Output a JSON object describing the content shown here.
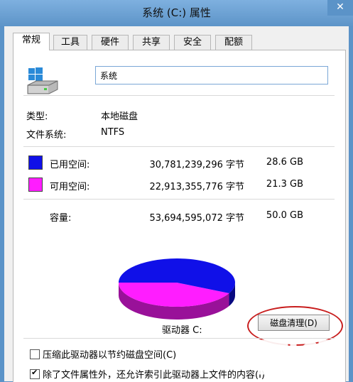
{
  "window": {
    "title": "系统 (C:) 属性",
    "close_glyph": "✕"
  },
  "tabs": [
    {
      "label": "常规",
      "active": true
    },
    {
      "label": "工具"
    },
    {
      "label": "硬件"
    },
    {
      "label": "共享"
    },
    {
      "label": "安全"
    },
    {
      "label": "配额"
    }
  ],
  "general": {
    "drive_icon": "hard-drive-icon",
    "name_value": "系统",
    "type_label": "类型:",
    "type_value": "本地磁盘",
    "fs_label": "文件系统:",
    "fs_value": "NTFS",
    "used": {
      "label": "已用空间:",
      "bytes": "30,781,239,296 字节",
      "size": "28.6 GB",
      "color": "#1010e8"
    },
    "free": {
      "label": "可用空间:",
      "bytes": "22,913,355,776 字节",
      "size": "21.3 GB",
      "color": "#ff1dff"
    },
    "capacity": {
      "label": "容量:",
      "bytes": "53,694,595,072 字节",
      "size": "50.0 GB"
    },
    "used_fraction": 0.573,
    "drive_label": "驱动器 C:",
    "cleanup_button": "磁盘清理(D)",
    "compress_checkbox": {
      "label": "压缩此驱动器以节约磁盘空间(C)",
      "checked": false
    },
    "index_checkbox": {
      "label": "除了文件属性外，还允许索引此驱动器上文件的内容(I)",
      "checked": true
    }
  },
  "annotation_color": "#c81e1e"
}
